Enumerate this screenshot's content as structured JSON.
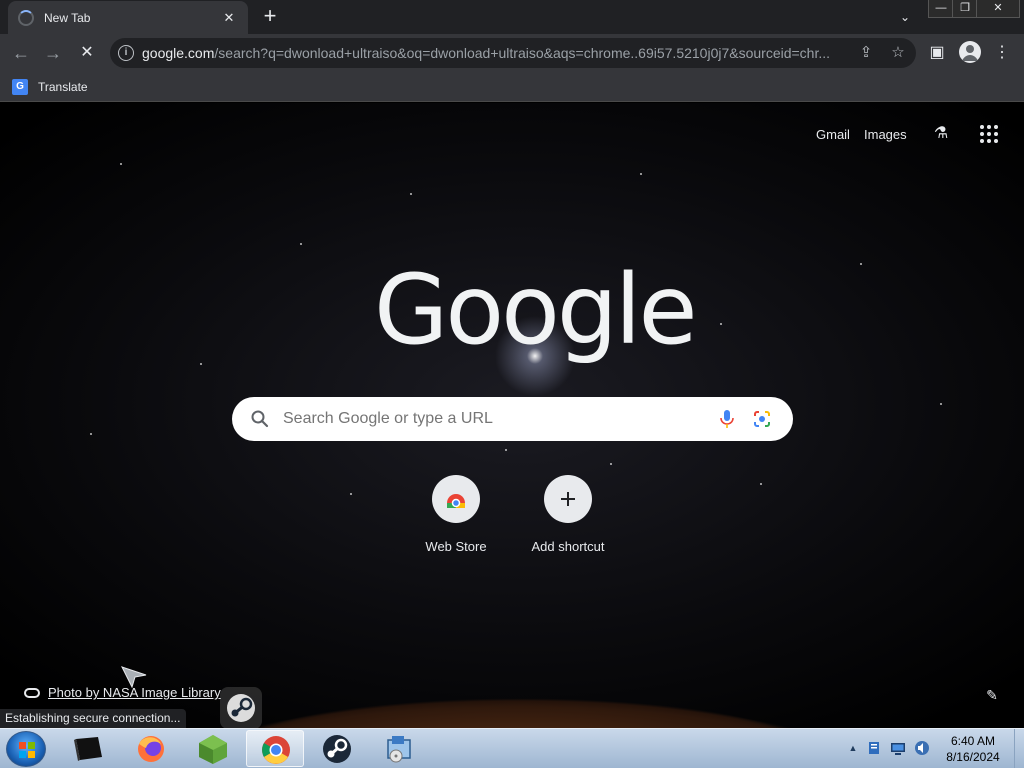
{
  "window": {
    "tab_title": "New Tab",
    "close_tab": "✕",
    "new_tab": "+",
    "tab_search": "⌄",
    "minimize": "—",
    "restore": "❐",
    "close": "✕"
  },
  "toolbar": {
    "back": "←",
    "forward": "→",
    "reload": "✕",
    "url_host": "google.com",
    "url_rest": "/search?q=dwonload+ultraiso&oq=dwonload+ultraiso&aqs=chrome..69i57.5210j0j7&sourceid=chr...",
    "share": "⇪",
    "bookmark_star": "☆",
    "side_panel": "▣",
    "menu": "⋮"
  },
  "bookmarks": [
    {
      "label": "Translate",
      "icon": "translate-icon"
    }
  ],
  "ntp": {
    "top_links": [
      "Gmail",
      "Images"
    ],
    "logo_text": "Google",
    "search_placeholder": "Search Google or type a URL",
    "shortcuts": [
      {
        "label": "Web Store",
        "icon": "web-store-icon"
      },
      {
        "label": "Add shortcut",
        "icon": "plus-icon"
      }
    ],
    "photo_credit": "Photo by NASA Image Library",
    "edit": "✎"
  },
  "status": {
    "text": "Establishing secure connection..."
  },
  "taskbar": {
    "apps": [
      "terminal-app",
      "firefox-app",
      "minecraft-app",
      "chrome-app",
      "steam-app",
      "installer-app"
    ],
    "active_app": "chrome-app",
    "tray_chevron": "▲",
    "time": "6:40 AM",
    "date": "8/16/2024"
  },
  "colors": {
    "tabstrip": "#202124",
    "toolbar": "#35363a",
    "text_light": "#e8eaed",
    "accent_blue": "#4285f4"
  }
}
